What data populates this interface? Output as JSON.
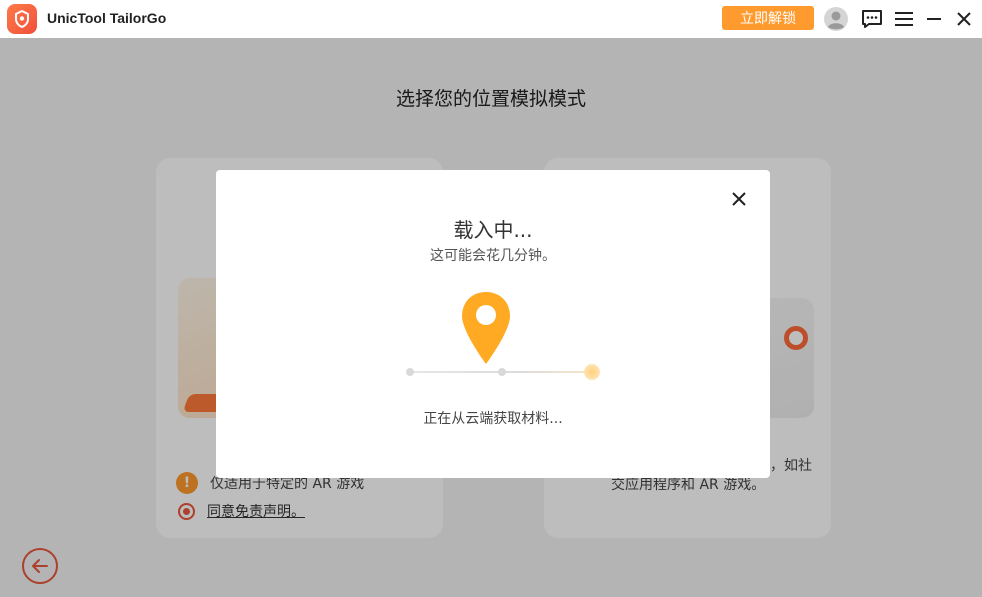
{
  "app": {
    "title": "UnicTool TailorGo",
    "unlock_label": "立即解锁",
    "icons": [
      "app-logo-icon",
      "avatar-icon",
      "feedback-icon",
      "menu-icon",
      "minimize-icon",
      "close-icon"
    ]
  },
  "main": {
    "title": "选择您的位置模拟模式",
    "left_card": {
      "warning_text": "仅适用于特定的 AR 游戏",
      "agree_text": "同意免责声明。"
    },
    "right_card": {
      "text_line1": "，如社",
      "text_line2": "交应用程序和 AR 游戏。"
    }
  },
  "modal": {
    "title": "载入中...",
    "subtitle": "这可能会花几分钟。",
    "status": "正在从云端获取材料..."
  },
  "colors": {
    "accent": "#ff9a2e",
    "brand_red": "#e9573c",
    "pin": "#ffaa22"
  }
}
